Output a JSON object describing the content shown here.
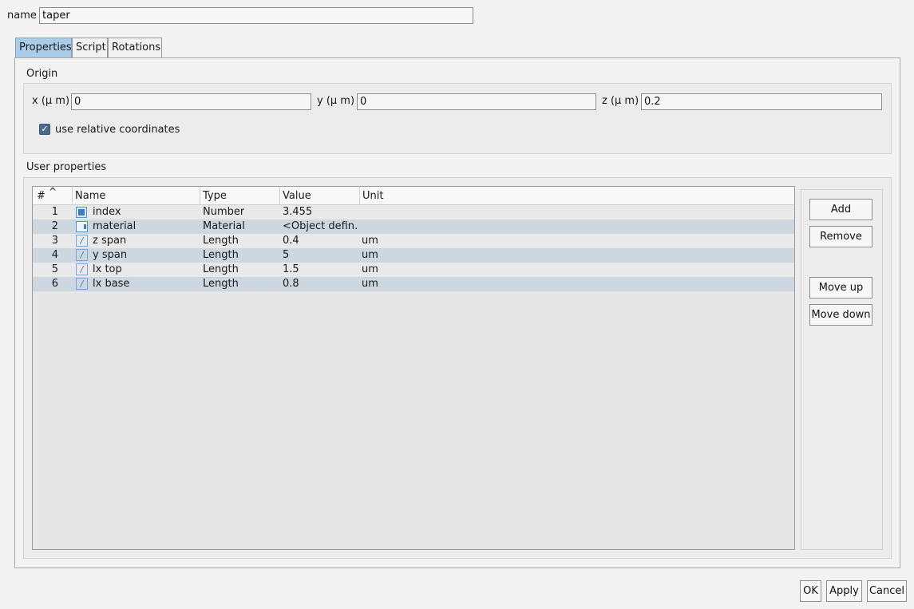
{
  "name_label": "name",
  "name_value": "taper",
  "tabs": [
    {
      "label": "Properties",
      "active": true
    },
    {
      "label": "Script",
      "active": false
    },
    {
      "label": "Rotations",
      "active": false
    }
  ],
  "origin": {
    "title": "Origin",
    "x_label": "x (μ m)",
    "x_value": "0",
    "y_label": "y (μ m)",
    "y_value": "0",
    "z_label": "z (μ m)",
    "z_value": "0.2",
    "relative_label": "use relative coordinates",
    "relative_checked": true
  },
  "user_properties": {
    "title": "User properties",
    "columns": [
      "#",
      "Name",
      "Type",
      "Value",
      "Unit"
    ],
    "sort_glyph": "^",
    "rows": [
      {
        "num": "1",
        "icon": "number-icon",
        "name": "index",
        "type": "Number",
        "value": "3.455",
        "unit": ""
      },
      {
        "num": "2",
        "icon": "material-icon",
        "name": "material",
        "type": "Material",
        "value": "<Object defin…",
        "unit": ""
      },
      {
        "num": "3",
        "icon": "length-icon",
        "name": "z span",
        "type": "Length",
        "value": "0.4",
        "unit": "um"
      },
      {
        "num": "4",
        "icon": "length-icon",
        "name": "y span",
        "type": "Length",
        "value": "5",
        "unit": "um"
      },
      {
        "num": "5",
        "icon": "length-icon",
        "name": "lx top",
        "type": "Length",
        "value": "1.5",
        "unit": "um"
      },
      {
        "num": "6",
        "icon": "length-icon",
        "name": "lx base",
        "type": "Length",
        "value": "0.8",
        "unit": "um"
      }
    ],
    "buttons": {
      "add": "Add",
      "remove": "Remove",
      "move_up": "Move up",
      "move_down": "Move down"
    }
  },
  "footer": {
    "ok": "OK",
    "apply": "Apply",
    "cancel": "Cancel"
  },
  "colors": {
    "tab_active": "#a9cde9",
    "row_alt": "#ccd7e0",
    "checkbox": "#4b6b8c"
  }
}
